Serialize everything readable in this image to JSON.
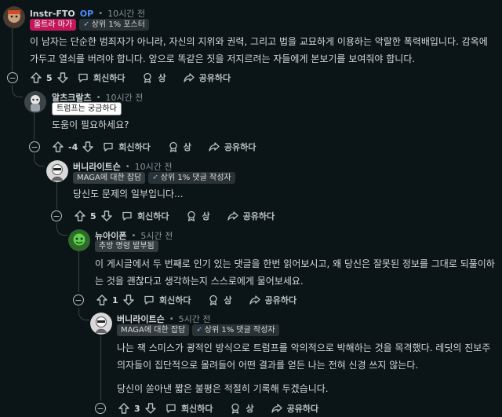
{
  "comments": [
    {
      "username": "lnstr-FTO",
      "op": "OP",
      "time": "10시간 전",
      "flair": "올트라 마가",
      "badge": "상위 1% 포스터",
      "body": [
        "이 남자는 단순한 범죄자가 아니라, 자신의 지위와 권력, 그리고 법을 교묘하게 이용하는 악랄한 폭력배입니다. 감옥에",
        "가두고 열쇠를 버려야 합니다. 앞으로 똑같은 짓을 저지르려는 자들에게 본보기를 보여줘야 합니다."
      ],
      "score": "5",
      "reply": "회신하다",
      "award": "상",
      "share": "공유하다"
    },
    {
      "username": "알츠크랄츠",
      "time": "10시간 전",
      "flair": "트럼프는 궁금하다",
      "body": [
        "도움이 필요하세요?"
      ],
      "score": "-4",
      "reply": "회신하다",
      "award": "상",
      "share": "공유하다"
    },
    {
      "username": "버니라이트슨",
      "time": "10시간 전",
      "flair": "MAGA에 대한 잡담",
      "badge": "상위 1% 댓글 작성자",
      "body": [
        "당신도 문제의 일부입니다..."
      ],
      "score": "5",
      "reply": "회신하다",
      "award": "상",
      "share": "공유하다"
    },
    {
      "username": "뉴아이폰",
      "time": "5시간 전",
      "flair": "추방 명령 발부됨",
      "body": [
        "이 게시글에서 두 번째로 인기 있는 댓글을 한번 읽어보시고, 왜 당신은 잘못된 정보를 그대로 되풀이하",
        "는 것을 괜찮다고 생각하는지 스스로에게 물어보세요."
      ],
      "score": "1",
      "reply": "회신하다",
      "award": "상",
      "share": "공유하다"
    },
    {
      "username": "버니라이트슨",
      "time": "5시간 전",
      "flair": "MAGA에 대한 잡담",
      "badge": "상위 1% 댓글 작성자",
      "body": [
        "나는 잭 스미스가 광적인 방식으로 트럼프를 악의적으로 박해하는 것을 목격했다. 레딧의 진보주",
        "의자들이 집단적으로 몰려들어 어떤 결과를 얻든 나는 전혀 신경 쓰지 않는다.",
        "",
        "당신이 쏟아낸 짧은 불평은 적절히 기록해 두겠습니다."
      ],
      "score": "3",
      "reply": "회신하다",
      "award": "상",
      "share": "공유하다"
    }
  ]
}
